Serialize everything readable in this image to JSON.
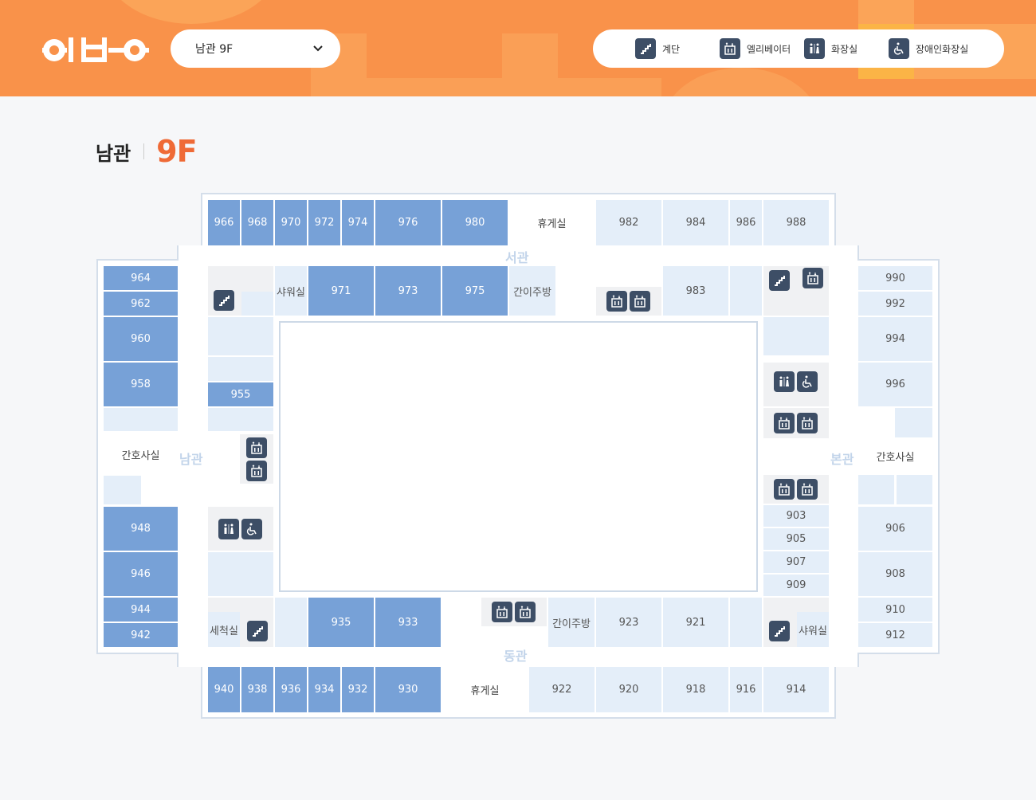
{
  "header": {
    "floor_select": "남관 9F",
    "legend": [
      {
        "icon": "stairs-icon",
        "label": "계단"
      },
      {
        "icon": "elevator-icon",
        "label": "엘리베이터"
      },
      {
        "icon": "restroom-icon",
        "label": "화장실"
      },
      {
        "icon": "accessible-restroom-icon",
        "label": "장애인화장실"
      }
    ]
  },
  "title": {
    "building": "남관",
    "floor": "9F"
  },
  "wings": {
    "west": "서관",
    "south": "남관",
    "main": "본관",
    "east": "동관"
  },
  "rooms": {
    "r966": "966",
    "r968": "968",
    "r970": "970",
    "r972": "972",
    "r974": "974",
    "r976": "976",
    "r980": "980",
    "lounge_top": "휴게실",
    "r982": "982",
    "r984": "984",
    "r986": "986",
    "r988": "988",
    "r964": "964",
    "r962": "962",
    "r960": "960",
    "r958": "958",
    "nurse_left": "간호사실",
    "r948": "948",
    "r946": "946",
    "r944": "944",
    "r942": "942",
    "shower_top": "샤워실",
    "r971": "971",
    "r973": "973",
    "r975": "975",
    "kitchen_top": "간이주방",
    "r983": "983",
    "r955": "955",
    "r990": "990",
    "r992": "992",
    "r994": "994",
    "r996": "996",
    "nurse_right": "간호사실",
    "r906": "906",
    "r908": "908",
    "r910": "910",
    "r912": "912",
    "r903": "903",
    "r905": "905",
    "r907": "907",
    "r909": "909",
    "wash": "세척실",
    "r935": "935",
    "r933": "933",
    "kitchen_bottom": "간이주방",
    "r923": "923",
    "r921": "921",
    "shower_bottom": "샤워실",
    "r940": "940",
    "r938": "938",
    "r936": "936",
    "r934": "934",
    "r932": "932",
    "r930": "930",
    "lounge_bottom": "휴게실",
    "r922": "922",
    "r920": "920",
    "r918": "918",
    "r916": "916",
    "r914": "914"
  },
  "colors": {
    "header": "#f9924a",
    "accent": "#ef6a36",
    "room_dark": "#77a1d7",
    "room_light": "#e4eef9",
    "icon_bg": "#3d4e66"
  }
}
